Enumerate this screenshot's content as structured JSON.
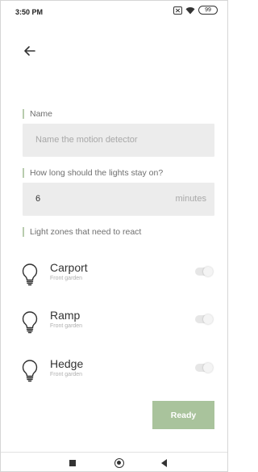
{
  "status_bar": {
    "time": "3:50 PM",
    "battery": "99",
    "icons": [
      "sim-card-icon",
      "wifi-icon",
      "battery-icon"
    ]
  },
  "header": {
    "back_icon": "arrow-left-icon"
  },
  "form": {
    "name_label": "Name",
    "name_placeholder": "Name the motion detector",
    "duration_label": "How long should the lights stay on?",
    "duration_value": "6",
    "duration_unit": "minutes",
    "zones_label": "Light zones that need to react"
  },
  "zones": [
    {
      "name": "Carport",
      "location": "Front garden",
      "enabled": false,
      "icon": "lightbulb-icon"
    },
    {
      "name": "Ramp",
      "location": "Front garden",
      "enabled": false,
      "icon": "lightbulb-icon"
    },
    {
      "name": "Hedge",
      "location": "Front garden",
      "enabled": false,
      "icon": "lightbulb-icon"
    }
  ],
  "actions": {
    "ready_label": "Ready"
  },
  "colors": {
    "accent": "#a9c39c",
    "label_bar": "#b8ccae",
    "field_bg": "#ececec"
  },
  "nav": {
    "icons": [
      "recents-square-icon",
      "home-circle-icon",
      "back-triangle-icon"
    ]
  }
}
